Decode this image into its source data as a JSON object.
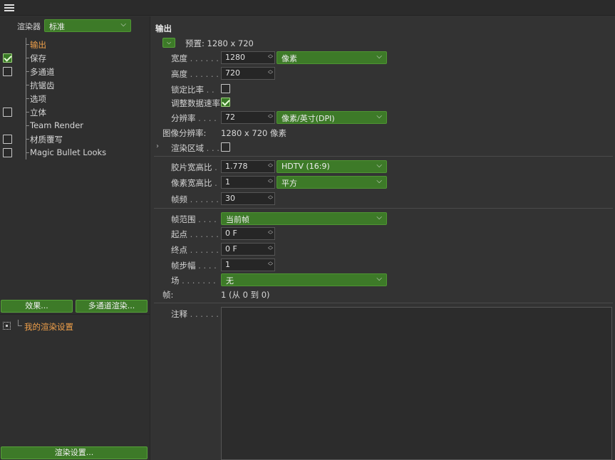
{
  "left_panel": {
    "renderer_label": "渲染器",
    "renderer_value": "标准",
    "items": [
      {
        "label": "输出",
        "checked": null,
        "active": true
      },
      {
        "label": "保存",
        "checked": true,
        "active": false
      },
      {
        "label": "多通道",
        "checked": false,
        "active": false
      },
      {
        "label": "抗锯齿",
        "checked": null,
        "active": false
      },
      {
        "label": "选项",
        "checked": null,
        "active": false
      },
      {
        "label": "立体",
        "checked": false,
        "active": false
      },
      {
        "label": "Team Render",
        "checked": null,
        "active": false
      },
      {
        "label": "材质覆写",
        "checked": false,
        "active": false
      },
      {
        "label": "Magic Bullet Looks",
        "checked": false,
        "active": false
      }
    ],
    "effects_button": "效果...",
    "multipass_button": "多通道渲染...",
    "my_render_setting": "我的渲染设置",
    "render_settings_button": "渲染设置..."
  },
  "output": {
    "section_title": "输出",
    "preset_label": "预置: 1280 x 720",
    "width_label": "宽度",
    "width_value": "1280",
    "unit_value": "像素",
    "height_label": "高度",
    "height_value": "720",
    "lock_ratio_label": "锁定比率",
    "lock_ratio_checked": false,
    "adjust_rate_label": "调整数据速率",
    "adjust_rate_checked": true,
    "resolution_label": "分辨率",
    "resolution_value": "72",
    "resolution_unit": "像素/英寸(DPI)",
    "image_res_label": "图像分辨率:",
    "image_res_value": "1280 x 720 像素",
    "render_region_label": "渲染区域",
    "render_region_checked": false,
    "film_aspect_label": "胶片宽高比",
    "film_aspect_value": "1.778",
    "film_aspect_preset": "HDTV (16:9)",
    "pixel_aspect_label": "像素宽高比",
    "pixel_aspect_value": "1",
    "pixel_aspect_preset": "平方",
    "fps_label": "帧频",
    "fps_value": "30",
    "frame_range_label": "帧范围",
    "frame_range_value": "当前帧",
    "start_label": "起点",
    "start_value": "0 F",
    "end_label": "终点",
    "end_value": "0 F",
    "step_label": "帧步幅",
    "step_value": "1",
    "field_label": "场",
    "field_value": "无",
    "frames_label": "帧:",
    "frames_value": "1 (从 0 到 0)",
    "notes_label": "注释"
  },
  "colors": {
    "accent_green": "#3d7a28",
    "active_orange": "#f0a04a",
    "panel_bg": "#333333"
  }
}
